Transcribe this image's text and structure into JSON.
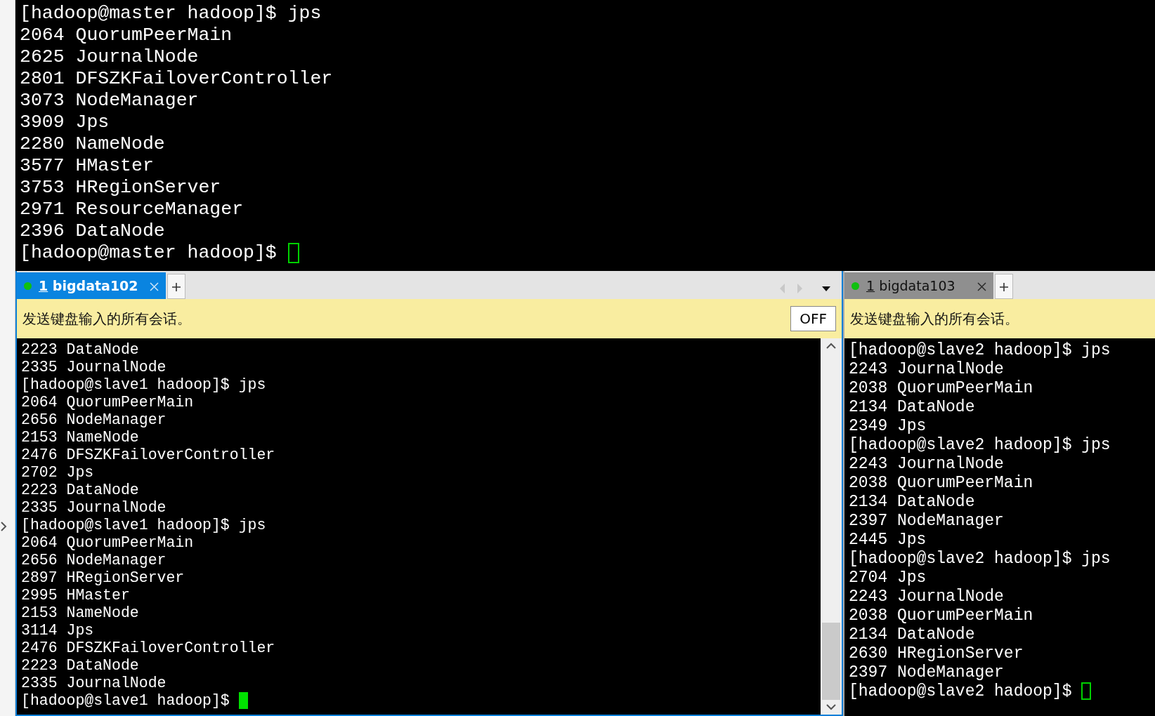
{
  "top_terminal": {
    "lines": [
      "[hadoop@master hadoop]$ jps",
      "2064 QuorumPeerMain",
      "2625 JournalNode",
      "2801 DFSZKFailoverController",
      "3073 NodeManager",
      "3909 Jps",
      "2280 NameNode",
      "3577 HMaster",
      "3753 HRegionServer",
      "2971 ResourceManager",
      "2396 DataNode"
    ],
    "prompt": "[hadoop@master hadoop]$ ",
    "cursor_filled": false
  },
  "panes": [
    {
      "tab": {
        "number": "1",
        "label": "bigdata102",
        "selected": true
      },
      "banner": "发送键盘输入的所有会话。",
      "off_button": "OFF",
      "lines": [
        "2223 DataNode",
        "2335 JournalNode",
        "[hadoop@slave1 hadoop]$ jps",
        "2064 QuorumPeerMain",
        "2656 NodeManager",
        "2153 NameNode",
        "2476 DFSZKFailoverController",
        "2702 Jps",
        "2223 DataNode",
        "2335 JournalNode",
        "[hadoop@slave1 hadoop]$ jps",
        "2064 QuorumPeerMain",
        "2656 NodeManager",
        "2897 HRegionServer",
        "2995 HMaster",
        "2153 NameNode",
        "3114 Jps",
        "2476 DFSZKFailoverController",
        "2223 DataNode",
        "2335 JournalNode"
      ],
      "prompt": "[hadoop@slave1 hadoop]$ ",
      "cursor_filled": true
    },
    {
      "tab": {
        "number": "1",
        "label": "bigdata103",
        "selected": false
      },
      "banner": "发送键盘输入的所有会话。",
      "lines": [
        "[hadoop@slave2 hadoop]$ jps",
        "2243 JournalNode",
        "2038 QuorumPeerMain",
        "2134 DataNode",
        "2349 Jps",
        "[hadoop@slave2 hadoop]$ jps",
        "2243 JournalNode",
        "2038 QuorumPeerMain",
        "2134 DataNode",
        "2397 NodeManager",
        "2445 Jps",
        "[hadoop@slave2 hadoop]$ jps",
        "2704 Jps",
        "2243 JournalNode",
        "2038 QuorumPeerMain",
        "2134 DataNode",
        "2630 HRegionServer",
        "2397 NodeManager"
      ],
      "prompt": "[hadoop@slave2 hadoop]$ ",
      "cursor_filled": false
    }
  ]
}
